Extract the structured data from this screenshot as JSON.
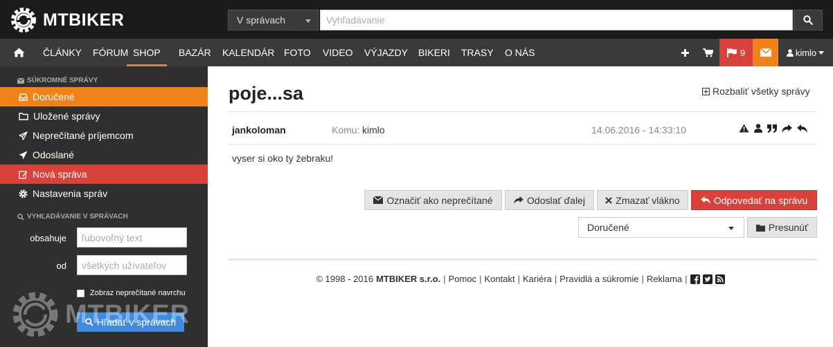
{
  "header": {
    "logo_text": "MTBIKER",
    "search_scope": "V správach",
    "search_placeholder": "Vyhľadávanie"
  },
  "nav": {
    "items": [
      "ČLÁNKY",
      "FÓRUM",
      "SHOP",
      "BAZÁR",
      "KALENDÁR",
      "FOTO",
      "VIDEO",
      "VÝJAZDY",
      "BIKERI",
      "TRASY",
      "O NÁS"
    ],
    "active": "SHOP",
    "flag_count": "9",
    "username": "kimlo"
  },
  "sidebar": {
    "section_title": "SÚKROMNÉ SPRÁVY",
    "items": [
      {
        "label": "Doručené",
        "icon": "inbox-icon"
      },
      {
        "label": "Uložené správy",
        "icon": "folder-icon"
      },
      {
        "label": "Neprečítané príjemcom",
        "icon": "paper-plane-outline-icon"
      },
      {
        "label": "Odoslané",
        "icon": "paper-plane-icon"
      },
      {
        "label": "Nová správa",
        "icon": "edit-icon"
      },
      {
        "label": "Nastavenia správ",
        "icon": "gear-icon"
      }
    ],
    "search_title": "VYHĽADÁVANIE V SPRÁVACH",
    "contains_label": "obsahuje",
    "contains_placeholder": "ľubovoľný text",
    "from_label": "od",
    "from_placeholder": "všetkých užívateľov",
    "unread_checkbox_label": "Zobraz neprečítané navrchu",
    "search_button": "Hľadať v správach",
    "watermark_text": "MTBIKER"
  },
  "thread": {
    "title": "poje...sa",
    "expand_all": "Rozbaliť všetky správy",
    "message": {
      "sender": "jankoloman",
      "to_label": "Komu:",
      "to_value": "kimlo",
      "date": "14.06.2016 - 14:33:10",
      "body": "vyser si oko ty žebraku!"
    },
    "actions": {
      "mark_unread": "Označiť ako neprečítané",
      "forward": "Odoslať ďalej",
      "delete_thread": "Zmazať vlákno",
      "reply": "Odpovedať na správu"
    },
    "folder_select": "Doručené",
    "move_button": "Presunúť"
  },
  "footer": {
    "copyright": "© 1998 - 2016",
    "company": "MTBIKER s.r.o.",
    "links": [
      "Pomoc",
      "Kontakt",
      "Kariéra",
      "Pravidlá a súkromie",
      "Reklama"
    ]
  },
  "colors": {
    "accent_orange": "#f08218",
    "accent_red": "#d9413a",
    "dark_header": "#1b1b1b",
    "nav_bg": "#3a3a3a",
    "sidebar_bg": "#2f2f2f",
    "search_button_blue": "#3f8be0"
  }
}
